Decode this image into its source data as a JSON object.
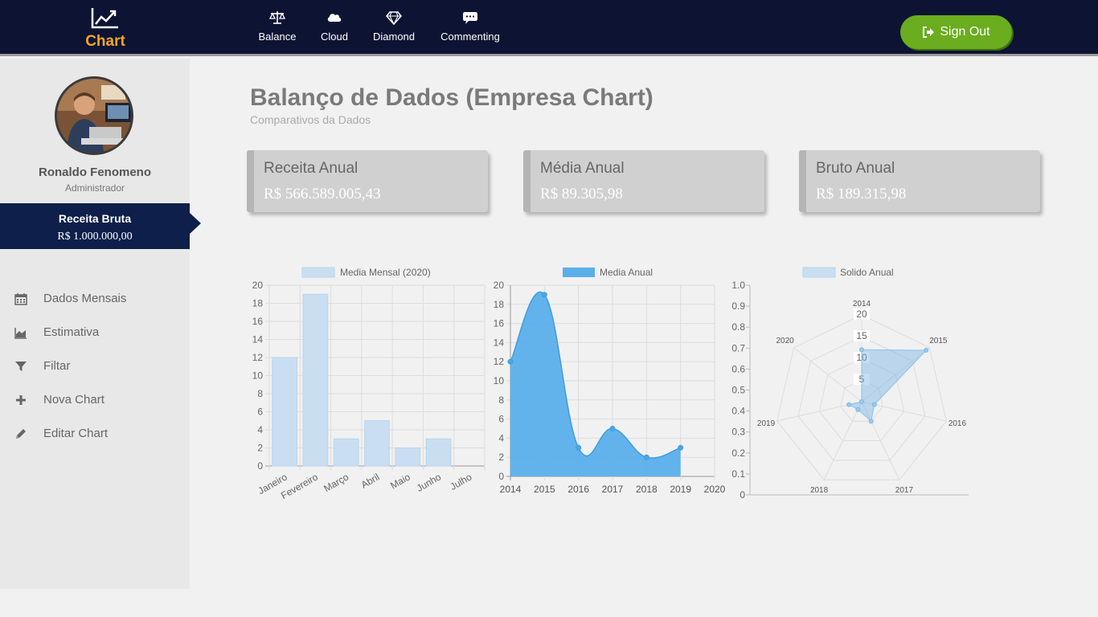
{
  "brand": {
    "label": "Chart"
  },
  "nav": [
    {
      "label": "Balance",
      "icon": "balance-scale-icon"
    },
    {
      "label": "Cloud",
      "icon": "cloud-icon"
    },
    {
      "label": "Diamond",
      "icon": "diamond-icon"
    },
    {
      "label": "Commenting",
      "icon": "commenting-icon"
    }
  ],
  "signout": {
    "label": "Sign Out",
    "icon": "sign-out-icon"
  },
  "user": {
    "name": "Ronaldo Fenomeno",
    "role": "Administrador"
  },
  "receita": {
    "title": "Receita Bruta",
    "value": "R$ 1.000.000,00"
  },
  "menu": [
    {
      "label": "Dados Mensais",
      "icon": "calendar-icon"
    },
    {
      "label": "Estimativa",
      "icon": "area-chart-icon"
    },
    {
      "label": "Filtar",
      "icon": "filter-icon"
    },
    {
      "label": "Nova Chart",
      "icon": "plus-icon"
    },
    {
      "label": "Editar Chart",
      "icon": "pencil-icon"
    }
  ],
  "page": {
    "title": "Balanço de Dados (Empresa Chart)",
    "subtitle": "Comparativos da Dados"
  },
  "cards": [
    {
      "title": "Receita Anual",
      "value": "R$ 566.589.005,43"
    },
    {
      "title": "Média Anual",
      "value": "R$ 89.305,98"
    },
    {
      "title": "Bruto Anual",
      "value": "R$ 189.315,98"
    }
  ],
  "colors": {
    "topbar": "#0d1333",
    "brand": "#f5a623",
    "signout": "#6aad1e",
    "receita_bg": "#0d1f4a",
    "bar_fill": "#c9dff1",
    "area_fill": "#5aafea"
  },
  "chart_data": [
    {
      "type": "bar",
      "legend": "Media Mensal (2020)",
      "categories": [
        "Janeiro",
        "Fevereiro",
        "Março",
        "Abril",
        "Maio",
        "Junho",
        "Julho"
      ],
      "values": [
        12,
        19,
        3,
        5,
        2,
        3,
        null
      ],
      "ylim": [
        0,
        20
      ],
      "yticks": [
        "0",
        "2",
        "4",
        "6",
        "8",
        "10",
        "12",
        "14",
        "16",
        "18",
        "20"
      ],
      "grid": true,
      "legend_position": "top"
    },
    {
      "type": "area",
      "legend": "Media Anual",
      "x": [
        "2014",
        "2015",
        "2016",
        "2017",
        "2018",
        "2019"
      ],
      "xticks": [
        "2014",
        "2015",
        "2016",
        "2017",
        "2018",
        "2019",
        "2020"
      ],
      "values": [
        12,
        19,
        3,
        5,
        2,
        3
      ],
      "ylim": [
        0,
        20
      ],
      "yticks": [
        "0",
        "2",
        "4",
        "6",
        "8",
        "10",
        "12",
        "14",
        "16",
        "18",
        "20"
      ],
      "grid": true,
      "legend_position": "top"
    },
    {
      "type": "radar",
      "legend": "Solido Anual",
      "categories": [
        "2014",
        "2015",
        "2016",
        "2017",
        "2018",
        "2019",
        "2020"
      ],
      "values": [
        12,
        19,
        3,
        5,
        2,
        3,
        null
      ],
      "r_ticks": [
        "5",
        "10",
        "15",
        "20"
      ],
      "r_max": 20,
      "yticks": [
        "0",
        "0.1",
        "0.2",
        "0.3",
        "0.4",
        "0.5",
        "0.6",
        "0.7",
        "0.8",
        "0.9",
        "1.0"
      ],
      "legend_position": "top"
    }
  ]
}
